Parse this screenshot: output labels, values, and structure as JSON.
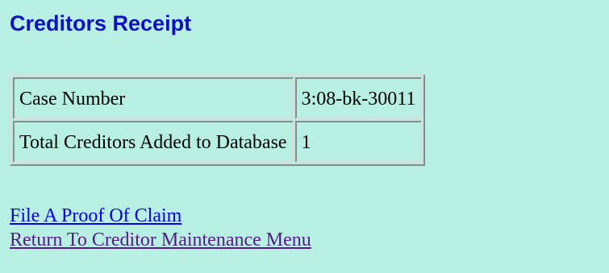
{
  "header": {
    "title": "Creditors Receipt"
  },
  "summary": {
    "rows": [
      {
        "label": "Case Number",
        "value": "3:08-bk-30011"
      },
      {
        "label": "Total Creditors Added to Database",
        "value": "1"
      }
    ]
  },
  "links": {
    "file_proof_of_claim": "File A Proof Of Claim",
    "return_menu": "Return To Creditor Maintenance Menu"
  },
  "colors": {
    "page_background": "#b7f0e2",
    "title": "#0b10c8",
    "link_unvisited": "#0000ee",
    "link_visited": "#551a8b"
  }
}
